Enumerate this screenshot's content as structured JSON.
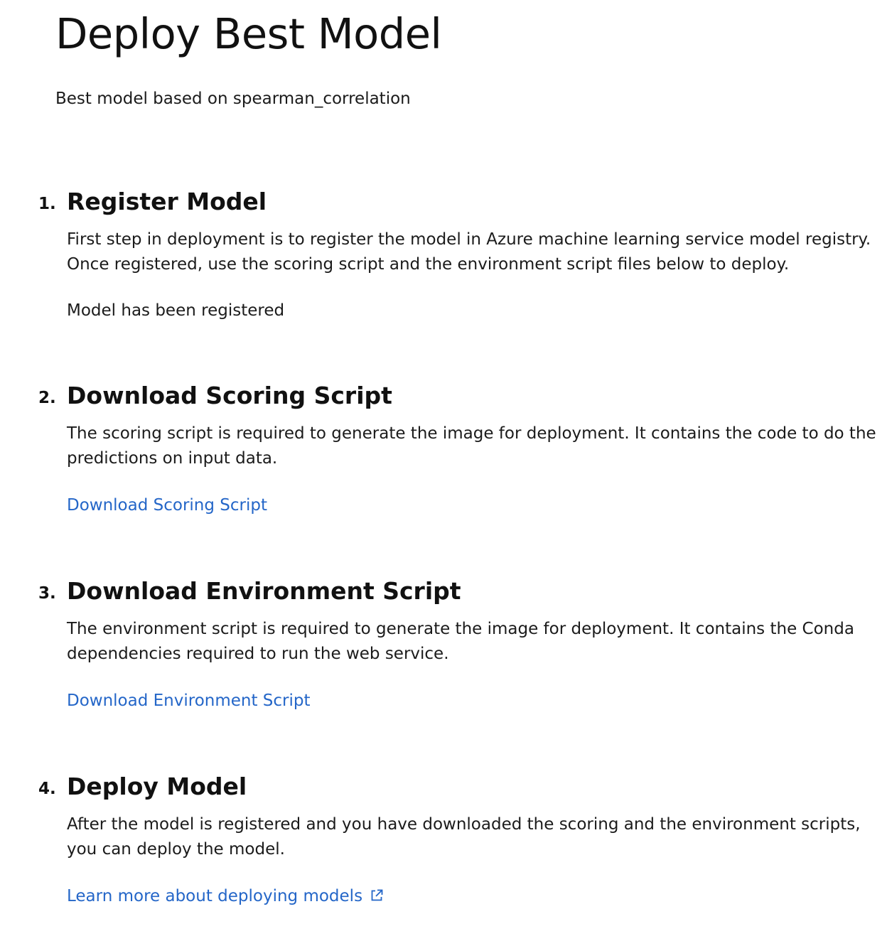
{
  "page": {
    "title": "Deploy Best Model",
    "subtitle": "Best model based on spearman_correlation"
  },
  "steps": [
    {
      "number": "1.",
      "heading": "Register Model",
      "body": "First step in deployment is to register the model in Azure machine learning service model registry. Once registered, use the scoring script and the environment script files below to deploy.",
      "status": "Model has been registered"
    },
    {
      "number": "2.",
      "heading": "Download Scoring Script",
      "body": "The scoring script is required to generate the image for deployment. It contains the code to do the predictions on input data.",
      "link": "Download Scoring Script"
    },
    {
      "number": "3.",
      "heading": "Download Environment Script",
      "body": "The environment script is required to generate the image for deployment. It contains the Conda dependencies required to run the web service.",
      "link": "Download Environment Script"
    },
    {
      "number": "4.",
      "heading": "Deploy Model",
      "body": "After the model is registered and you have downloaded the scoring and the environment scripts, you can deploy the model.",
      "link": "Learn more about deploying models",
      "link_icon": "external-link-icon"
    }
  ],
  "colors": {
    "link": "#2466c8",
    "text": "#1b1b1b",
    "heading": "#111111"
  }
}
